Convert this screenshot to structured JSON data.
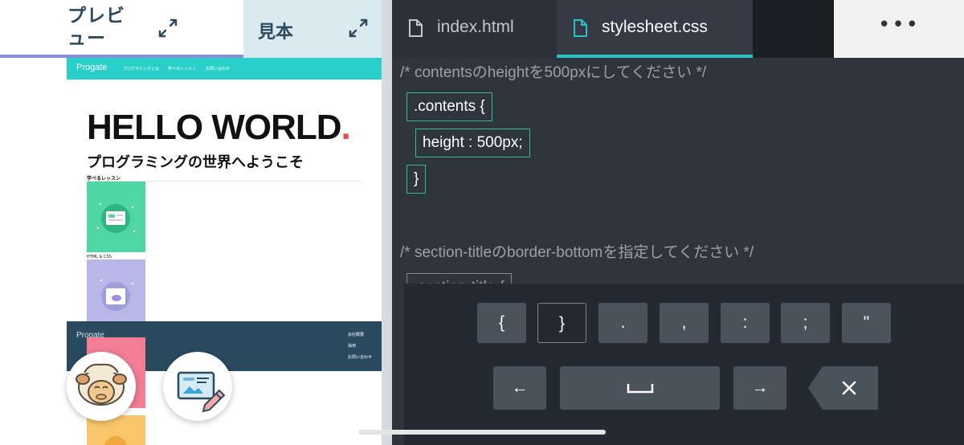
{
  "left_tabs": {
    "preview_label": "プレビュー",
    "sample_label": "見本"
  },
  "preview": {
    "header": {
      "logo": "Progate",
      "nav": [
        "プログラミングとは",
        "学べるレッスン",
        "お問い合わせ"
      ]
    },
    "hero": {
      "title": "HELLO WORLD",
      "title_dot": ".",
      "subtitle": "プログラミングの世界へようこそ"
    },
    "lessons_label": "学べるレッスン",
    "card_label": "HTML & CSS",
    "footer": {
      "logo": "Progate",
      "links": [
        "会社概要",
        "採用",
        "お問い合わせ"
      ]
    }
  },
  "editor": {
    "tabs": [
      {
        "name": "index.html"
      },
      {
        "name": "stylesheet.css"
      }
    ],
    "more_label": "•••",
    "code": {
      "comment1": "/* contentsのheightを500pxにしてください */",
      "selector": ".contents {",
      "property": "height : 500px;",
      "close": "}",
      "comment2": "/* section-titleのborder-bottomを指定してください */",
      "selector2": ".section-title {"
    }
  },
  "keyboard": {
    "row1": [
      "{",
      "}",
      ".",
      ",",
      ":",
      ";",
      "\""
    ],
    "row2": {
      "left": "←",
      "space": "␣",
      "right": "→",
      "delete": "✕"
    }
  },
  "colors": {
    "accent": "#29c2c4",
    "highlight_box": "#3cb98a",
    "progate_header": "#29d0c9",
    "hello_dot": "#e94b4b"
  }
}
